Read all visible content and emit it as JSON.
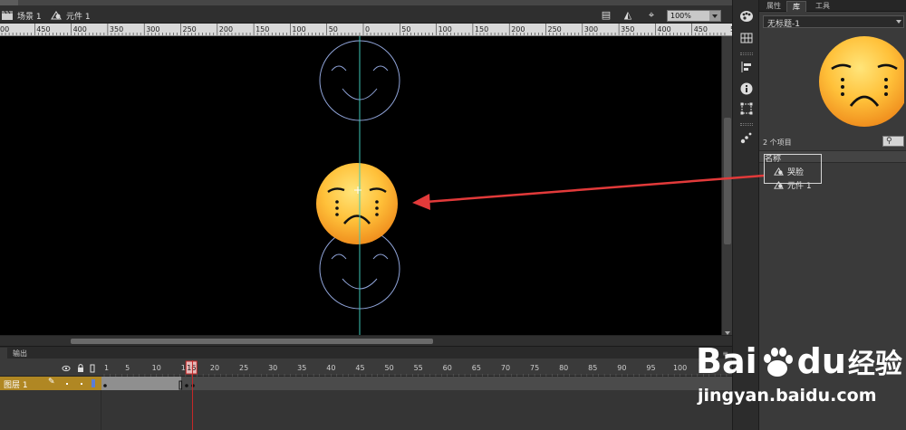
{
  "editbar": {
    "scene_label": "场景 1",
    "symbol_label": "元件 1",
    "zoom_value": "100%"
  },
  "ruler": {
    "labels": [
      "00",
      "450",
      "400",
      "350",
      "300",
      "250",
      "200",
      "150",
      "100",
      "50",
      "0",
      "50",
      "100",
      "150",
      "200",
      "250",
      "300",
      "350",
      "400",
      "450",
      "500"
    ]
  },
  "panel": {
    "tabs": [
      "属性",
      "库",
      "工具"
    ],
    "active_tab": "库",
    "document": "无标题-1",
    "item_count": "2 个项目",
    "column_header": "名称",
    "items": [
      {
        "name": "哭脸",
        "icon": "graphic-symbol-icon"
      },
      {
        "name": "元件 1",
        "icon": "graphic-symbol-icon"
      }
    ]
  },
  "timeline": {
    "tabs": [
      "",
      "输出"
    ],
    "frame_numbers": [
      "1",
      "5",
      "10",
      "15",
      "20",
      "25",
      "30",
      "35",
      "40",
      "45",
      "50",
      "55",
      "60",
      "65",
      "70",
      "75",
      "80",
      "85",
      "90",
      "95",
      "100"
    ],
    "current_frame": "16",
    "layer_name": "图层 1",
    "layer_color": "#5b7dd6"
  },
  "colors": {
    "stage": "#000000",
    "guide_line": "#40c8b8",
    "face_outline": "#8fa3d8",
    "annotation_arrow": "#e23a3a",
    "playhead": "#c52828"
  },
  "watermark": {
    "logo_text_a": "Bai",
    "logo_text_b": "du",
    "logo_text_c": "经验",
    "url": "jingyan.baidu.com"
  }
}
